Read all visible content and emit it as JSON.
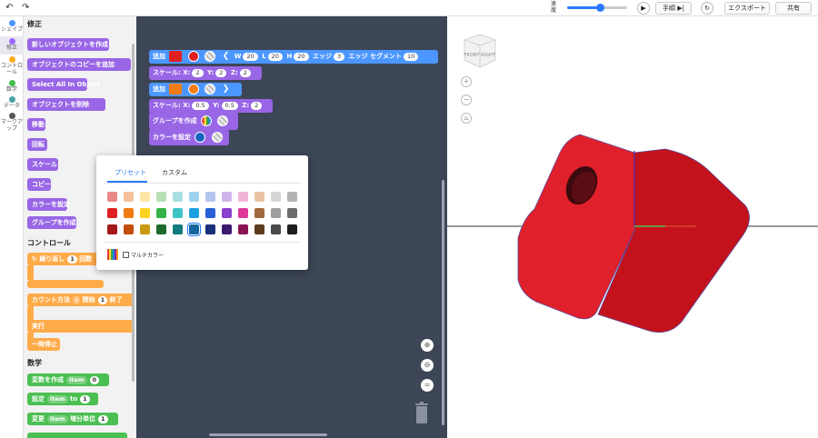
{
  "topbar": {
    "undo_icon": "undo-arrow-icon",
    "redo_icon": "redo-arrow-icon",
    "speed_label": "速度",
    "speed_value": 0.55,
    "play_icon": "play-icon",
    "step_label": "手順",
    "step_icon": "step-forward-icon",
    "reset_icon": "reset-icon",
    "export_label": "エクスポート",
    "share_label": "共有"
  },
  "categories": [
    {
      "label": "シェイプ",
      "color": "#4c97ff"
    },
    {
      "label": "修正",
      "color": "#9966ff"
    },
    {
      "label": "コントロール",
      "color": "#ffab19"
    },
    {
      "label": "数学",
      "color": "#40bf4a"
    },
    {
      "label": "データ",
      "color": "#4aa3a8"
    },
    {
      "label": "マークアップ",
      "color": "#555555"
    }
  ],
  "palette": {
    "modify_title": "修正",
    "modify_blocks": [
      "新しいオブジェクトを作成",
      "オブジェクトのコピーを追加",
      "Select All In Object",
      "オブジェクトを削除",
      "移動",
      "回転",
      "スケール",
      "コピー",
      "カラーを設定",
      "グループを作成"
    ],
    "control_title": "コントロール",
    "repeat_label": "繰り返し",
    "repeat_count": "1",
    "repeat_suffix": "回数",
    "count_label": "カウント方法",
    "count_var": "i",
    "count_start_label": "開始",
    "count_start": "1",
    "count_end_label": "終了",
    "do_label": "実行",
    "pause_label": "一時停止",
    "math_title": "数学",
    "var_create_label": "変数を作成",
    "var_create_name": "item",
    "var_create_value": "0",
    "set_label": "設定",
    "set_name": "item",
    "set_to": "to",
    "set_value": "1",
    "change_label": "変更",
    "change_name": "item",
    "change_by": "増分単位",
    "change_value": "1"
  },
  "workspace": {
    "row1": {
      "label": "追加",
      "shape_color": "#e02020",
      "color": "#e02020",
      "w_label": "W",
      "w": "20",
      "l_label": "L",
      "l": "20",
      "h_label": "H",
      "h": "20",
      "edge_label": "エッジ",
      "edge": "3",
      "seg_label": "エッジ セグメント",
      "seg": "10"
    },
    "row2": {
      "label": "スケール:",
      "x_label": "X:",
      "x": "2",
      "y_label": "Y:",
      "y": "2",
      "z_label": "Z:",
      "z": "2"
    },
    "row3": {
      "label": "追加",
      "shape_color": "#f07c12",
      "color": "#f07c12"
    },
    "row4": {
      "label": "スケール:",
      "x_label": "X:",
      "x": "0.5",
      "y_label": "Y:",
      "y": "0.5",
      "z_label": "Z:",
      "z": "2"
    },
    "row5": {
      "label": "グループを作成"
    },
    "row6": {
      "label": "カラーを設定",
      "color": "#1565c0"
    }
  },
  "color_popup": {
    "tab_preset": "プリセット",
    "tab_custom": "カスタム",
    "multicolor_label": "マルチカラー",
    "swatches": [
      [
        "#e88a8a",
        "#f5c09a",
        "#fde5a8",
        "#b8e0b4",
        "#a8dfe0",
        "#9ed3ef",
        "#b3c6ef",
        "#cfb6ea",
        "#f0b6d6",
        "#e9c4a2",
        "#d6d6d6",
        "#b3b3b3"
      ],
      [
        "#e02020",
        "#f07c12",
        "#fbd21f",
        "#34b24a",
        "#3cc4c8",
        "#1aa0e0",
        "#2b5fd9",
        "#8a3fcf",
        "#e0389a",
        "#a06a3c",
        "#9e9e9e",
        "#6b6b6b"
      ],
      [
        "#a31a1a",
        "#c24e0c",
        "#c99a10",
        "#1e6b2c",
        "#127a7d",
        "#1565a0",
        "#1a2f7a",
        "#3d1a70",
        "#8c1454",
        "#5e3b1c",
        "#4a4a4a",
        "#1e1e1e"
      ]
    ],
    "selected": [
      2,
      5
    ]
  },
  "viewport": {
    "cube_front": "FRONT",
    "cube_right": "RIGHT",
    "zoom_in_icon": "plus-icon",
    "zoom_out_icon": "minus-icon",
    "home_icon": "home-icon",
    "object_color": "#e0202a"
  }
}
